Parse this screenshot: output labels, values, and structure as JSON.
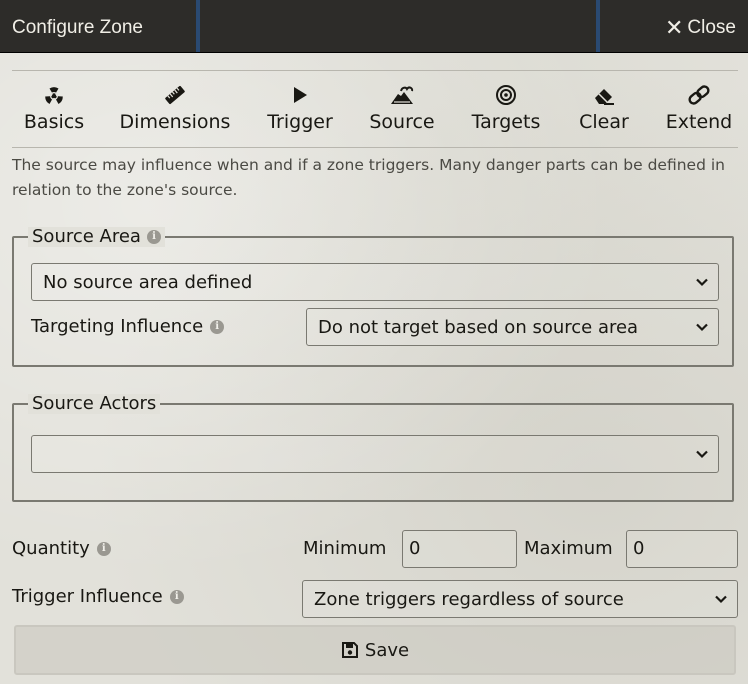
{
  "header": {
    "title": "Configure Zone",
    "close_label": "Close"
  },
  "tabs": [
    {
      "label": "Basics",
      "icon": "radiation-icon"
    },
    {
      "label": "Dimensions",
      "icon": "ruler-icon"
    },
    {
      "label": "Trigger",
      "icon": "play-icon"
    },
    {
      "label": "Source",
      "icon": "volcano-icon"
    },
    {
      "label": "Targets",
      "icon": "bullseye-icon"
    },
    {
      "label": "Clear",
      "icon": "eraser-icon"
    },
    {
      "label": "Extend",
      "icon": "link-icon"
    }
  ],
  "hint": "The source may influence when and if a zone triggers. Many danger parts can be defined in relation to the zone's source.",
  "source_area": {
    "legend": "Source Area",
    "area_select": "No source area defined",
    "targeting_label": "Targeting Influence",
    "targeting_select": "Do not target based on source area"
  },
  "source_actors": {
    "legend": "Source Actors",
    "actors_select": ""
  },
  "quantity": {
    "label": "Quantity",
    "min_label": "Minimum",
    "min_value": "0",
    "max_label": "Maximum",
    "max_value": "0"
  },
  "trigger_influence": {
    "label": "Trigger Influence",
    "select": "Zone triggers regardless of source"
  },
  "save_label": "Save",
  "colors": {
    "header_bg": "#2d2c29",
    "panel_bg": "#e2e1da",
    "border": "#7a7971"
  }
}
